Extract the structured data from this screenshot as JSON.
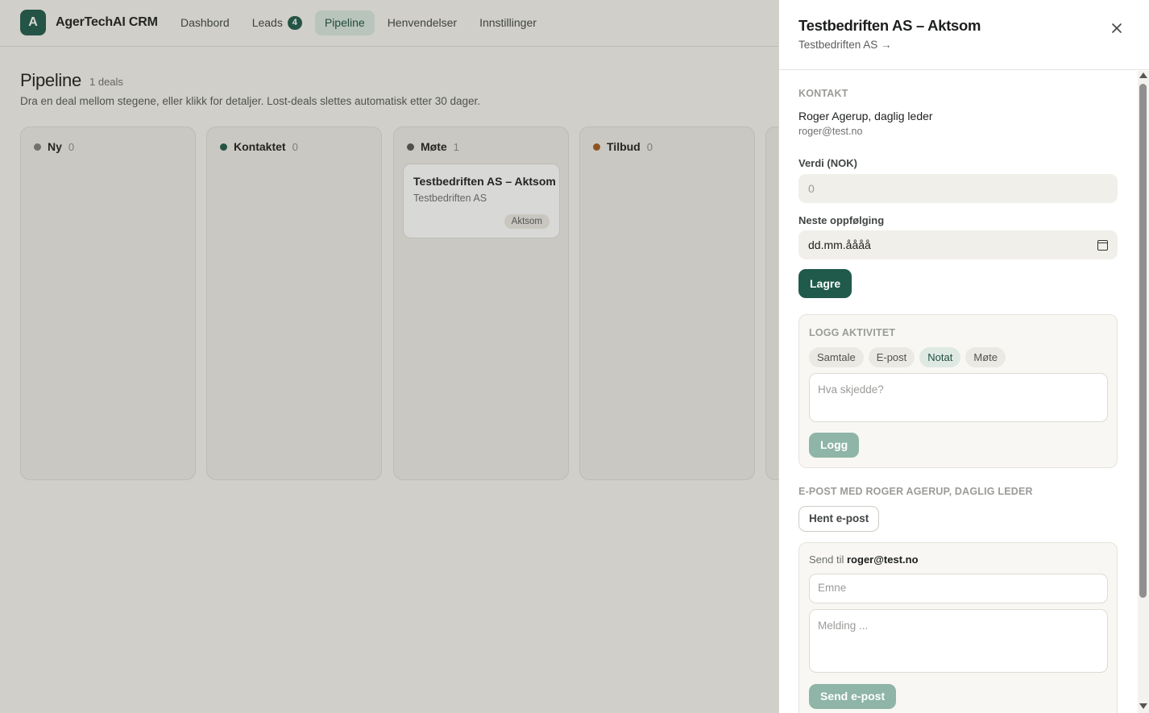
{
  "app": {
    "logo_letter": "A",
    "brand": "AgerTechAI CRM",
    "nav": [
      {
        "label": "Dashbord"
      },
      {
        "label": "Leads",
        "badge": "4"
      },
      {
        "label": "Pipeline"
      },
      {
        "label": "Henvendelser"
      },
      {
        "label": "Innstillinger"
      }
    ]
  },
  "pipeline": {
    "title": "Pipeline",
    "count": "1 deals",
    "subtitle": "Dra en deal mellom stegene, eller klikk for detaljer. Lost-deals slettes automatisk etter 30 dager.",
    "columns": [
      {
        "name": "Ny",
        "count": "0",
        "color": "#7f7f7f"
      },
      {
        "name": "Kontaktet",
        "count": "0",
        "color": "#1f5a4a"
      },
      {
        "name": "Møte",
        "count": "1",
        "color": "#555555"
      },
      {
        "name": "Tilbud",
        "count": "0",
        "color": "#a25a1f"
      }
    ],
    "card": {
      "title": "Testbedriften AS – Aktsom",
      "company": "Testbedriften AS",
      "tag": "Aktsom"
    }
  },
  "drawer": {
    "title": "Testbedriften AS – Aktsom",
    "company_link": "Testbedriften AS →",
    "contact_label": "KONTAKT",
    "contact_name": "Roger Agerup, daglig leder",
    "contact_email": "roger@test.no",
    "value_label": "Verdi (NOK)",
    "value_placeholder": "0",
    "followup_label": "Neste oppfølging",
    "followup_value": "dd.mm.åååå",
    "save_label": "Lagre",
    "activity_label": "LOGG AKTIVITET",
    "activity_types": [
      "Samtale",
      "E-post",
      "Notat",
      "Møte"
    ],
    "activity_placeholder": "Hva skjedde?",
    "log_label": "Logg",
    "email_section_label": "E-POST MED ROGER AGERUP, DAGLIG LEDER",
    "fetch_email_label": "Hent e-post",
    "send_to_prefix": "Send til",
    "send_to_email": "roger@test.no",
    "subject_placeholder": "Emne",
    "message_placeholder": "Melding ...",
    "send_label": "Send e-post"
  }
}
